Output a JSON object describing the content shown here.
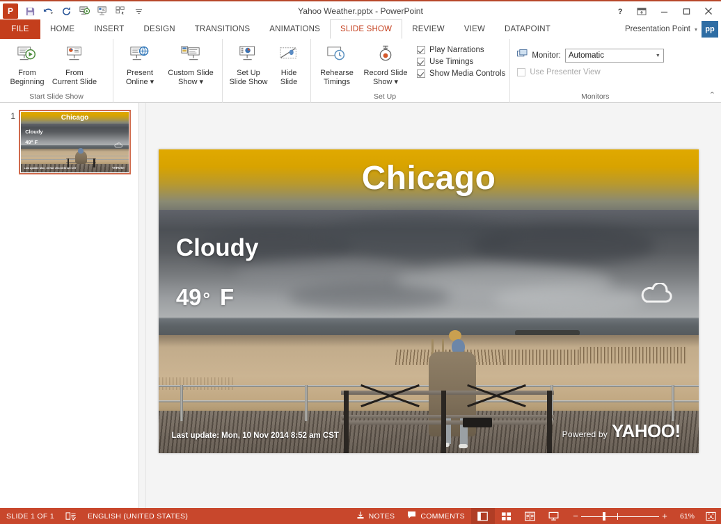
{
  "window": {
    "title": "Yahoo Weather.pptx - PowerPoint",
    "app_icon_label": "P",
    "quick_access": [
      {
        "name": "save-icon",
        "label": "Save"
      },
      {
        "name": "undo-icon",
        "label": "Undo"
      },
      {
        "name": "redo-icon",
        "label": "Repeat"
      },
      {
        "name": "start-from-beginning-icon",
        "label": "Start From Beginning"
      },
      {
        "name": "present-icon",
        "label": "Present"
      },
      {
        "name": "customize-icon",
        "label": "Customize"
      },
      {
        "name": "customize-quick-access-toolbar-icon",
        "label": "Customize Quick Access Toolbar"
      }
    ],
    "controls": [
      {
        "name": "help-button",
        "label": "?"
      },
      {
        "name": "ribbon-display-options-button",
        "label": "Ribbon Display Options"
      },
      {
        "name": "minimize-button",
        "label": "Minimize"
      },
      {
        "name": "restore-button",
        "label": "Restore Down"
      },
      {
        "name": "close-button",
        "label": "Close"
      }
    ]
  },
  "account": {
    "name": "Presentation Point",
    "initials": "pp",
    "caret": "▾"
  },
  "tabs": {
    "file": "FILE",
    "items": [
      {
        "label": "HOME",
        "active": false
      },
      {
        "label": "INSERT",
        "active": false
      },
      {
        "label": "DESIGN",
        "active": false
      },
      {
        "label": "TRANSITIONS",
        "active": false
      },
      {
        "label": "ANIMATIONS",
        "active": false
      },
      {
        "label": "SLIDE SHOW",
        "active": true
      },
      {
        "label": "REVIEW",
        "active": false
      },
      {
        "label": "VIEW",
        "active": false
      },
      {
        "label": "DATAPOINT",
        "active": false
      }
    ]
  },
  "ribbon": {
    "groups": [
      {
        "name": "start-slide-show",
        "label": "Start Slide Show",
        "buttons": [
          {
            "name": "from-beginning-button",
            "line1": "From",
            "line2": "Beginning"
          },
          {
            "name": "from-current-slide-button",
            "line1": "From",
            "line2": "Current Slide"
          },
          {
            "name": "present-online-button",
            "line1": "Present",
            "line2": "Online ▾"
          },
          {
            "name": "custom-slide-show-button",
            "line1": "Custom Slide",
            "line2": "Show ▾"
          }
        ]
      },
      {
        "name": "set-up",
        "label": "Set Up",
        "buttons": [
          {
            "name": "set-up-slide-show-button",
            "line1": "Set Up",
            "line2": "Slide Show"
          },
          {
            "name": "hide-slide-button",
            "line1": "Hide",
            "line2": "Slide"
          },
          {
            "name": "rehearse-timings-button",
            "line1": "Rehearse",
            "line2": "Timings"
          },
          {
            "name": "record-slide-show-button",
            "line1": "Record Slide",
            "line2": "Show ▾"
          }
        ],
        "checkboxes": [
          {
            "name": "play-narrations-checkbox",
            "label": "Play Narrations",
            "checked": true,
            "enabled": true
          },
          {
            "name": "use-timings-checkbox",
            "label": "Use Timings",
            "checked": true,
            "enabled": true
          },
          {
            "name": "show-media-controls-checkbox",
            "label": "Show Media Controls",
            "checked": true,
            "enabled": true
          }
        ]
      },
      {
        "name": "monitors",
        "label": "Monitors",
        "monitor_label": "Monitor:",
        "monitor_value": "Automatic",
        "monitor_options": [
          "Automatic"
        ],
        "presenter_view": {
          "name": "use-presenter-view-checkbox",
          "label": "Use Presenter View",
          "checked": false,
          "enabled": false
        }
      }
    ],
    "collapse_label": "⌃"
  },
  "thumbnail": {
    "number": "1"
  },
  "slide": {
    "city": "Chicago",
    "condition": "Cloudy",
    "temperature": "49",
    "degree_symbol": "°",
    "unit": "F",
    "last_update": "Last update:  Mon, 10 Nov 2014 8:52 am CST",
    "powered_by_text": "Powered by",
    "powered_by_brand": "YAHOO!",
    "weather_icon": "cloud-icon",
    "accent_sky_color": "#d8a300"
  },
  "status_bar": {
    "slide_count": "SLIDE 1 OF 1",
    "spellcheck_icon": "spellcheck-icon",
    "language": "ENGLISH (UNITED STATES)",
    "notes_label": "NOTES",
    "comments_label": "COMMENTS",
    "views": [
      {
        "name": "normal-view-button",
        "label": "Normal",
        "active": true
      },
      {
        "name": "slide-sorter-view-button",
        "label": "Slide Sorter",
        "active": false
      },
      {
        "name": "reading-view-button",
        "label": "Reading View",
        "active": false
      },
      {
        "name": "slide-show-view-button",
        "label": "Slide Show",
        "active": false
      }
    ],
    "zoom_out": "−",
    "zoom_in": "+",
    "zoom_level": "61%",
    "fit_label": "Fit slide to current window",
    "bar_color": "#c8472c"
  }
}
